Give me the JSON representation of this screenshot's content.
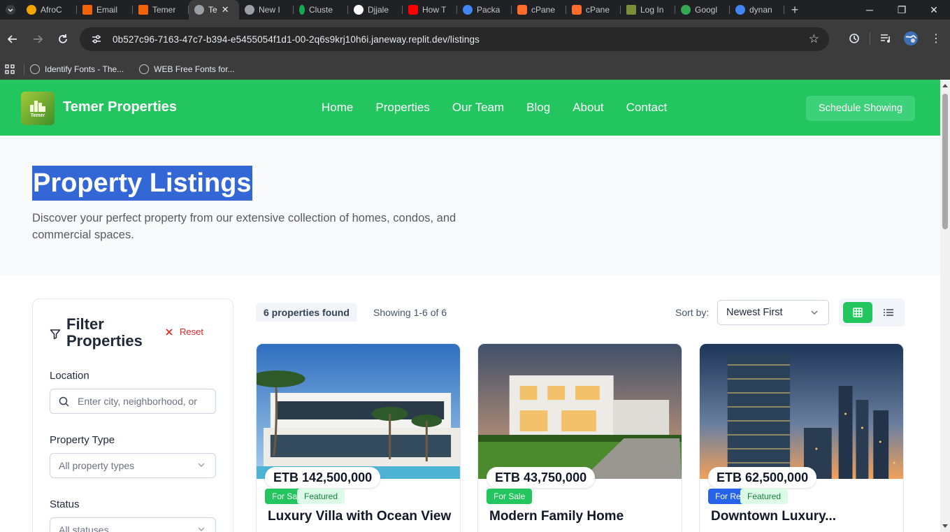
{
  "browser": {
    "tabs": [
      {
        "title": "AfroC",
        "color": "#f0a500"
      },
      {
        "title": "Email",
        "color": "#f26207"
      },
      {
        "title": "Temer",
        "color": "#f26207"
      },
      {
        "title": "Te",
        "color": "#9aa0a6",
        "active": true
      },
      {
        "title": "New I",
        "color": "#9aa0a6"
      },
      {
        "title": "Cluste",
        "color": "#13aa52"
      },
      {
        "title": "Djjale",
        "color": "#ffffff"
      },
      {
        "title": "How T",
        "color": "#ff0000"
      },
      {
        "title": "Packa",
        "color": "#4285f4"
      },
      {
        "title": "cPane",
        "color": "#ff6c2c"
      },
      {
        "title": "cPane",
        "color": "#ff6c2c"
      },
      {
        "title": "Log In",
        "color": "#7a8f3a"
      },
      {
        "title": "Googl",
        "color": "#34a853"
      },
      {
        "title": "dynan",
        "color": "#4285f4"
      }
    ],
    "url": "0b527c96-7163-47c7-b394-e5455054f1d1-00-2q6s9krj10h6i.janeway.replit.dev/listings",
    "bookmarks": [
      "Identify Fonts - The...",
      "WEB Free Fonts for..."
    ]
  },
  "site": {
    "brand": "Temer Properties",
    "logo_text": "Temer",
    "nav": [
      "Home",
      "Properties",
      "Our Team",
      "Blog",
      "About",
      "Contact"
    ],
    "cta": "Schedule Showing"
  },
  "hero": {
    "title": "Property Listings",
    "subtitle": "Discover your perfect property from our extensive collection of homes, condos, and commercial spaces."
  },
  "filters": {
    "title": "Filter Properties",
    "reset": "Reset",
    "location_label": "Location",
    "location_placeholder": "Enter city, neighborhood, or",
    "type_label": "Property Type",
    "type_value": "All property types",
    "status_label": "Status",
    "status_value": "All statuses"
  },
  "results": {
    "found": "6 properties found",
    "showing": "Showing 1-6 of 6",
    "sort_label": "Sort by:",
    "sort_value": "Newest First"
  },
  "colors": {
    "brand_green": "#22c55e",
    "rent_blue": "#2563eb",
    "danger_red": "#dc2626"
  },
  "listings": [
    {
      "price": "ETB 142,500,000",
      "status": "For Sale",
      "featured": "Featured",
      "title": "Luxury Villa with Ocean View"
    },
    {
      "price": "ETB 43,750,000",
      "status": "For Sale",
      "title": "Modern Family Home"
    },
    {
      "price": "ETB 62,500,000",
      "status": "For Rent",
      "featured": "Featured",
      "title": "Downtown Luxury..."
    }
  ]
}
